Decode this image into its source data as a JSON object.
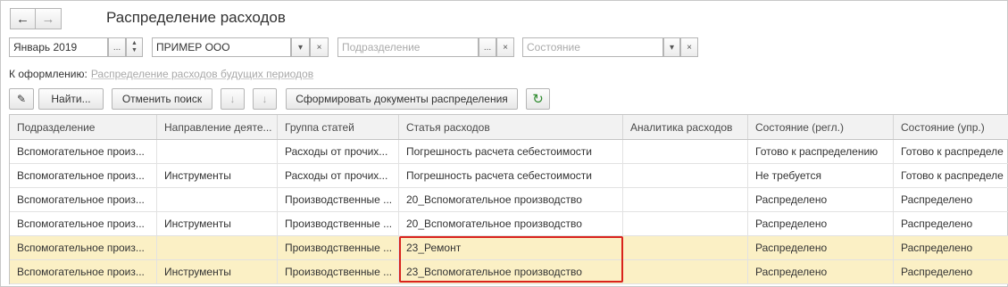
{
  "header": {
    "title": "Распределение расходов",
    "back_icon": "←",
    "forward_icon": "→"
  },
  "filters": {
    "period": {
      "value": "Январь 2019",
      "dots": "...",
      "spin_up": "▲",
      "spin_down": "▼"
    },
    "organization": {
      "value": "ПРИМЕР ООО",
      "drop": "▾",
      "clear": "×"
    },
    "department": {
      "placeholder": "Подразделение",
      "dots": "...",
      "clear": "×"
    },
    "state": {
      "placeholder": "Состояние",
      "drop": "▾",
      "clear": "×"
    }
  },
  "for_processing": {
    "label": "К оформлению:",
    "link": "Распределение расходов будущих периодов"
  },
  "toolbar": {
    "edit_icon": "✎",
    "find": "Найти...",
    "cancel_search": "Отменить поиск",
    "sort_asc_icon": "↓",
    "sort_desc_icon": "↓",
    "form_docs": "Сформировать документы распределения",
    "refresh_icon": "↻"
  },
  "table": {
    "columns": [
      "Подразделение",
      "Направление деяте...",
      "Группа статей",
      "Статья расходов",
      "Аналитика расходов",
      "Состояние (регл.)",
      "Состояние (упр.)"
    ],
    "rows": [
      [
        "Вспомогательное произ...",
        "",
        "Расходы от прочих...",
        "Погрешность расчета себестоимости",
        "",
        "Готово к распределению",
        "Готово к распределе"
      ],
      [
        "Вспомогательное произ...",
        "Инструменты",
        "Расходы от прочих...",
        "Погрешность расчета себестоимости",
        "",
        "Не требуется",
        "Готово к распределе"
      ],
      [
        "Вспомогательное произ...",
        "",
        "Производственные ...",
        "20_Вспомогательное производство",
        "",
        "Распределено",
        "Распределено"
      ],
      [
        "Вспомогательное произ...",
        "Инструменты",
        "Производственные ...",
        "20_Вспомогательное производство",
        "",
        "Распределено",
        "Распределено"
      ],
      [
        "Вспомогательное произ...",
        "",
        "Производственные ...",
        "23_Ремонт",
        "",
        "Распределено",
        "Распределено"
      ],
      [
        "Вспомогательное произ...",
        "Инструменты",
        "Производственные ...",
        "23_Вспомогательное производство",
        "",
        "Распределено",
        "Распределено"
      ]
    ],
    "selected_rows": [
      4,
      5
    ]
  },
  "colors": {
    "selected_row": "#fbf0c5",
    "highlight_border": "#d9231c",
    "refresh_icon": "#2e8b2e"
  }
}
